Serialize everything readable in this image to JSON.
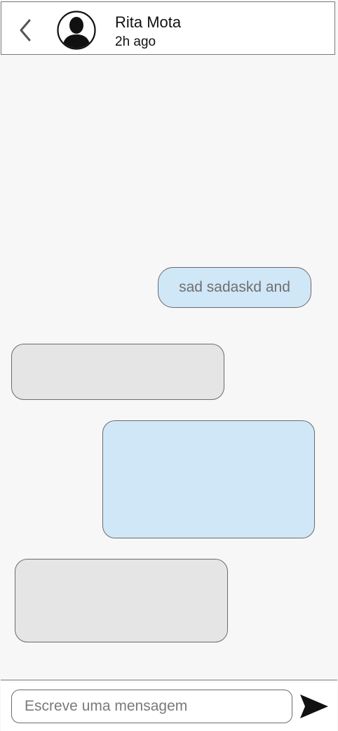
{
  "header": {
    "contact_name": "Rita Mota",
    "status": "2h ago",
    "back_icon": "chevron-left-icon",
    "avatar_icon": "user-silhouette-icon"
  },
  "messages": [
    {
      "direction": "outgoing",
      "text": "sad sadaskd and"
    },
    {
      "direction": "incoming",
      "text": ""
    },
    {
      "direction": "outgoing",
      "text": ""
    },
    {
      "direction": "incoming",
      "text": ""
    }
  ],
  "composer": {
    "input_value": "",
    "placeholder": "Escreve uma mensagem",
    "send_icon": "send-icon"
  },
  "colors": {
    "background": "#f7f7f7",
    "outgoing_bubble": "#d0e7f7",
    "incoming_bubble": "#e5e5e5",
    "border": "#6b6b6b"
  }
}
